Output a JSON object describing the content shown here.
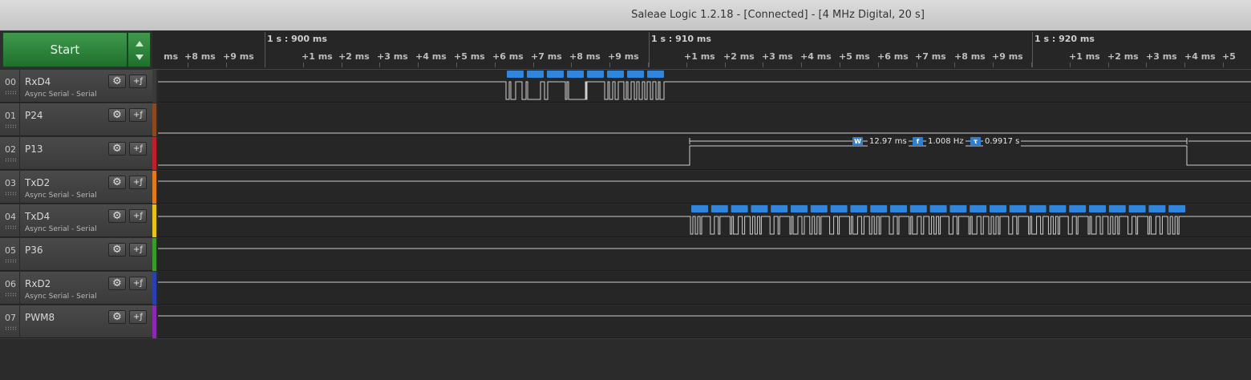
{
  "window": {
    "title": "Saleae Logic 1.2.18 - [Connected] - [4 MHz Digital, 20 s]"
  },
  "controls": {
    "start_label": "Start"
  },
  "ruler": {
    "major": [
      "1 s : 900 ms",
      "1 s : 910 ms",
      "1 s : 920 ms"
    ],
    "minor": [
      "ms",
      "+8 ms",
      "+9 ms",
      "+1 ms",
      "+2 ms",
      "+3 ms",
      "+4 ms",
      "+5 ms",
      "+6 ms",
      "+7 ms",
      "+8 ms",
      "+9 ms",
      "+1 ms",
      "+2 ms",
      "+3 ms",
      "+4 ms",
      "+5 ms",
      "+6 ms",
      "+7 ms",
      "+8 ms",
      "+9 ms",
      "+1 ms",
      "+2 ms",
      "+3 ms",
      "+4 ms",
      "+5"
    ]
  },
  "channels": [
    {
      "num": "00",
      "name": "RxD4",
      "analyzer": "Async Serial - Serial",
      "color": "#3a3a3a"
    },
    {
      "num": "01",
      "name": "P24",
      "analyzer": "",
      "color": "#8b4a1e"
    },
    {
      "num": "02",
      "name": "P13",
      "analyzer": "",
      "color": "#c0202a"
    },
    {
      "num": "03",
      "name": "TxD2",
      "analyzer": "Async Serial - Serial",
      "color": "#e07a1a"
    },
    {
      "num": "04",
      "name": "TxD4",
      "analyzer": "Async Serial - Serial",
      "color": "#e6c21a"
    },
    {
      "num": "05",
      "name": "P36",
      "analyzer": "",
      "color": "#3a9a2a"
    },
    {
      "num": "06",
      "name": "RxD2",
      "analyzer": "Async Serial - Serial",
      "color": "#2a3fb0"
    },
    {
      "num": "07",
      "name": "PWM8",
      "analyzer": "",
      "color": "#8a2ab0"
    }
  ],
  "measurement": {
    "width_icon": "W",
    "width": "12.97 ms",
    "freq_icon": "f",
    "freq": "1.008 Hz",
    "period_icon": "τ",
    "period": "0.9917 s"
  },
  "colors": {
    "decoded_frame": "#2f86dc",
    "signal": "#cfcfcf"
  }
}
